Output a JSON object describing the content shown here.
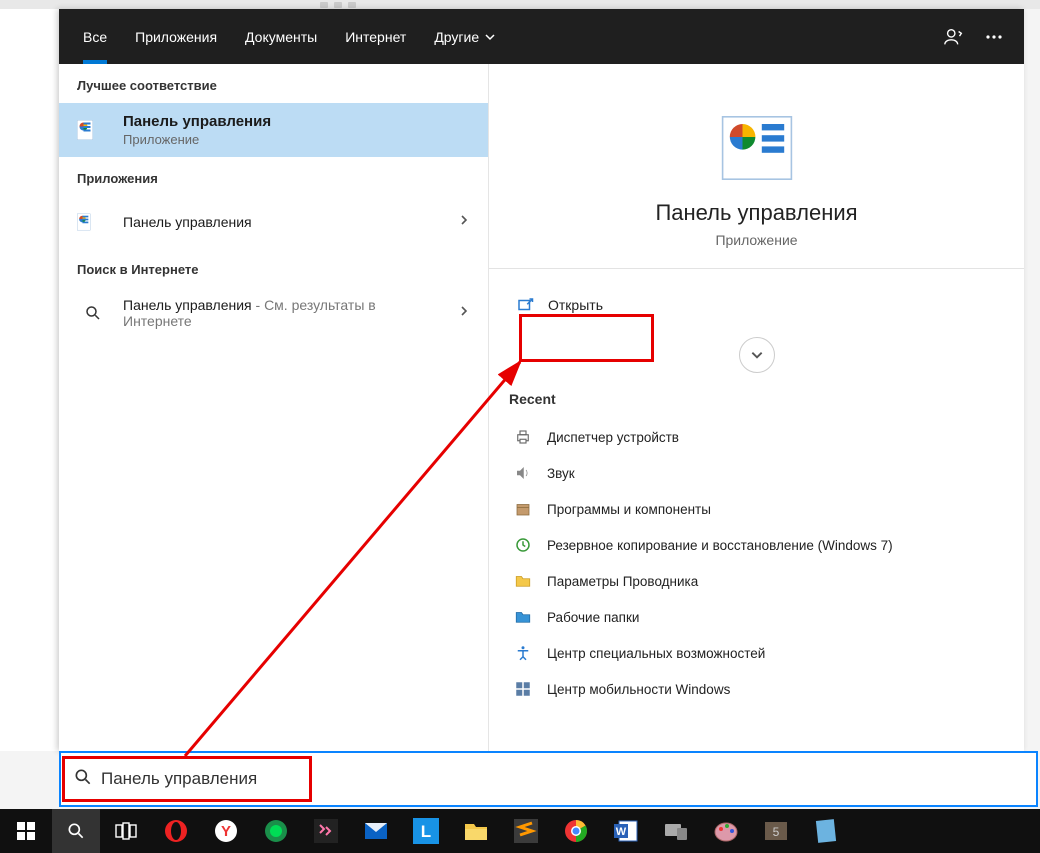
{
  "tabs": {
    "all": "Все",
    "apps": "Приложения",
    "docs": "Документы",
    "web": "Интернет",
    "more": "Другие"
  },
  "left": {
    "best_match": "Лучшее соответствие",
    "best": {
      "title": "Панель управления",
      "sub": "Приложение"
    },
    "apps_label": "Приложения",
    "app_item": {
      "title": "Панель управления"
    },
    "web_label": "Поиск в Интернете",
    "web_item": {
      "title": "Панель управления",
      "suffix": " - См. результаты в Интернете"
    }
  },
  "preview": {
    "title": "Панель управления",
    "sub": "Приложение",
    "open": "Открыть",
    "recent_label": "Recent",
    "recent": [
      "Диспетчер устройств",
      "Звук",
      "Программы и компоненты",
      "Резервное копирование и восстановление (Windows 7)",
      "Параметры Проводника",
      "Рабочие папки",
      "Центр специальных возможностей",
      "Центр мобильности Windows"
    ]
  },
  "search": {
    "value": "Панель управления"
  },
  "colors": {
    "accent": "#0078d4",
    "highlight": "#e60000",
    "selection": "#bcdcf4"
  }
}
